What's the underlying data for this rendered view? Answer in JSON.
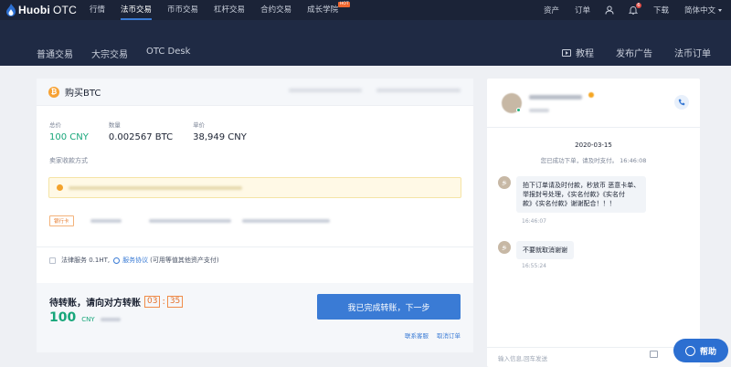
{
  "topnav": {
    "logo_brand": "Huobi",
    "logo_suffix": "OTC",
    "items": [
      {
        "label": "行情",
        "active": false
      },
      {
        "label": "法币交易",
        "active": true
      },
      {
        "label": "币币交易",
        "active": false
      },
      {
        "label": "杠杆交易",
        "active": false
      },
      {
        "label": "合约交易",
        "active": false
      },
      {
        "label": "成长学院",
        "active": false
      }
    ],
    "hot_badge": "HOT",
    "assets": "资产",
    "orders": "订单",
    "notification_count": "6",
    "download": "下载",
    "language": "简体中文"
  },
  "subnav": {
    "left": [
      "普通交易",
      "大宗交易",
      "OTC Desk"
    ],
    "tutorial": "教程",
    "post_ad": "发布广告",
    "fiat_orders": "法币订单"
  },
  "order": {
    "title": "购买BTC",
    "total_label": "总价",
    "total_value": "100 CNY",
    "qty_label": "数量",
    "qty_value": "0.002567 BTC",
    "price_label": "单价",
    "price_value": "38,949 CNY",
    "payment_section_label": "卖家收款方式",
    "bank_tag": "银行卡",
    "agree_text": "法律服务 0.1HT,",
    "service_link": "服务协议",
    "agree_note": "(可用等值其他资产支付)",
    "wait_text": "待转账，请向对方转账",
    "timer_min": "03",
    "timer_sec": "35",
    "amount": "100",
    "amount_currency": "CNY",
    "done_button": "我已完成转账，下一步",
    "contact_support": "联系客服",
    "cancel_order": "取消订单"
  },
  "chat": {
    "date": "2020-03-15",
    "system_msg": "您已成功下单，请及时支付。 16:46:08",
    "avatar_char": "乡",
    "messages": [
      {
        "text_lines": [
          "拍下订单请及时付款，秒放币 恶意卡单、",
          "举报封号处理，《实名付款》《实名付",
          "款》《实名付款》谢谢配合！！！"
        ],
        "time": "16:46:07"
      },
      {
        "text_lines": [
          "不要就取消谢谢"
        ],
        "time": "16:55:24"
      }
    ],
    "input_placeholder": "输入信息,回车发送"
  },
  "help_button": "帮助",
  "colors": {
    "topbar": "#1b2337",
    "subbar": "#1f2a44",
    "accent_blue": "#3a7bd5",
    "green": "#17a67a",
    "orange": "#e5702a"
  }
}
